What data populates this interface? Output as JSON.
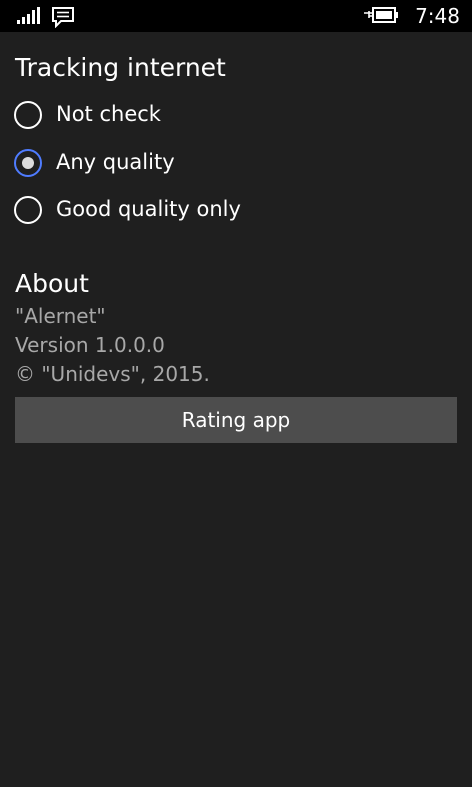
{
  "status_bar": {
    "icons": [
      "signal-strength-icon",
      "message-icon",
      "battery-charging-icon"
    ],
    "time": "7:48"
  },
  "tracking": {
    "title": "Tracking internet",
    "options": [
      {
        "label": "Not check",
        "selected": false
      },
      {
        "label": "Any quality",
        "selected": true
      },
      {
        "label": "Good quality only",
        "selected": false
      }
    ]
  },
  "about": {
    "title": "About",
    "app_name": "\"Alernet\"",
    "version": "Version 1.0.0.0",
    "copyright": "© \"Unidevs\", 2015.",
    "rating_button_label": "Rating app"
  },
  "colors": {
    "background": "#1f1f1f",
    "status_bar": "#000000",
    "accent": "#4f7cff",
    "secondary_text": "#a8a8a8",
    "button": "#4d4d4d"
  }
}
